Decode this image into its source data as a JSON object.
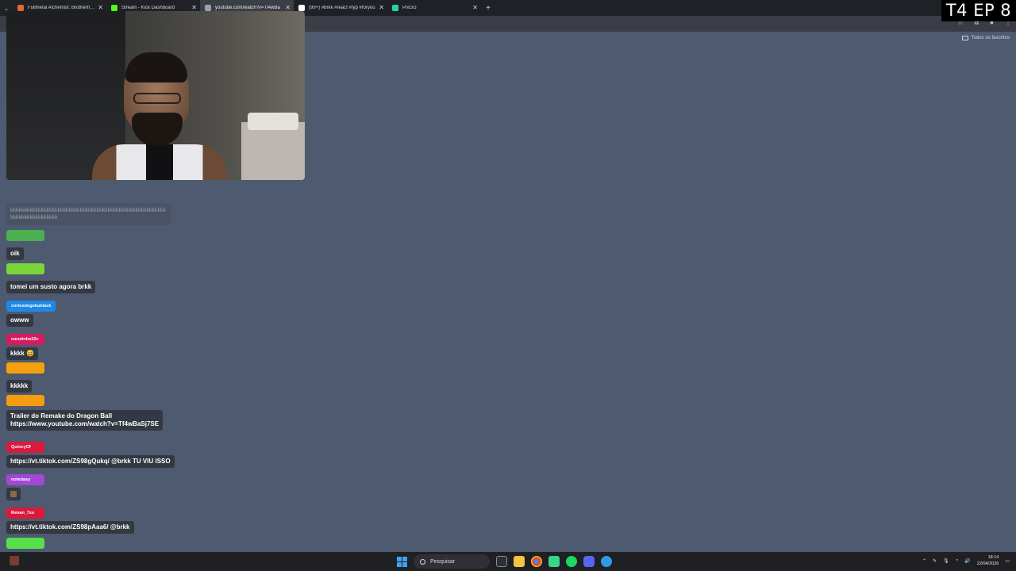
{
  "browser": {
    "tabs": [
      {
        "title": "Fullmetal Alchemist: Brotherhood",
        "favicon_color": "#e06b2a",
        "active": false
      },
      {
        "title": "Stream - Kick Dashboard",
        "favicon_color": "#53fc18",
        "active": false
      },
      {
        "title": "youtube.com/watch?v=Tf4wBa",
        "favicon_color": "#9aa0aa",
        "active": true
      },
      {
        "title": "(99+) #brkk #react #fyp #foryou",
        "favicon_color": "#ffffff",
        "active": false
      },
      {
        "title": "PixGG",
        "favicon_color": "#2ad1a8",
        "active": false
      }
    ],
    "bookmarks_folder": "Todos os favoritos"
  },
  "episode_label": "T4 EP 8",
  "chat": {
    "faded_message": "kkkkkkkkkkkkkkkkkkkkkkkkkkkkkkkkkkkkkkkkkkkkkkkkkkkkkkkkkkkkkkkkkkkkkkkkk",
    "messages": [
      {
        "user": "",
        "user_color": "#4caf50",
        "text": "oik"
      },
      {
        "user": "",
        "user_color": "#7bd63a",
        "text": "tomei um susto agora brkk"
      },
      {
        "user": "cortesdogokublack",
        "user_color": "#1e88e5",
        "text": "owww"
      },
      {
        "user": "narutinho22c",
        "user_color": "#d81b60",
        "text": "kkkk 😅"
      },
      {
        "user": "",
        "user_color": "#f5a00f",
        "text": "kkkkk"
      },
      {
        "user": "",
        "user_color": "#f59d10",
        "text": "Trailer do Remake do Dragon Ball",
        "text2": "https://www.youtube.com/watch?v=Tf4wBaSj7SE"
      },
      {
        "user": "QuincyOf",
        "user_color": "#d81b3c",
        "text": "https://vt.tiktok.com/ZS98gQukq/ @brkk TU VIU ISSO"
      },
      {
        "user": "notedasy",
        "user_color": "#a347d6",
        "text": ""
      },
      {
        "user": "Renan_7xs",
        "user_color": "#d81b3c",
        "text": "https://vt.tiktok.com/ZS98pAaa6/ @brkk"
      },
      {
        "user": "",
        "user_color": "#56e04a",
        "text": ""
      }
    ]
  },
  "taskbar": {
    "search_placeholder": "Pesquisar",
    "time": "18:14",
    "date": "22/04/2026"
  }
}
